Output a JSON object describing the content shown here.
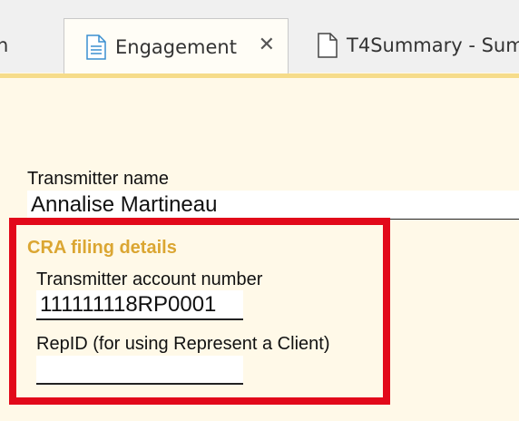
{
  "tabs": {
    "left_partial": "n",
    "active": {
      "label": "Engagement",
      "icon": "document-icon",
      "close_symbol": "✕"
    },
    "right": {
      "label": "T4Summary - Sum",
      "icon": "document-icon"
    }
  },
  "form": {
    "transmitter_name_label": "Transmitter name",
    "transmitter_name_value": "Annalise Martineau",
    "cra_section_title": "CRA filing details",
    "account_number_label": "Transmitter account number",
    "account_number_value": "111111118RP0001",
    "repid_label": "RepID (for using Represent a Client)",
    "repid_value": ""
  },
  "colors": {
    "background": "#fff9e8",
    "section_title": "#dba632",
    "highlight": "#e2091a",
    "tab_accent": "#f6dc8a"
  }
}
